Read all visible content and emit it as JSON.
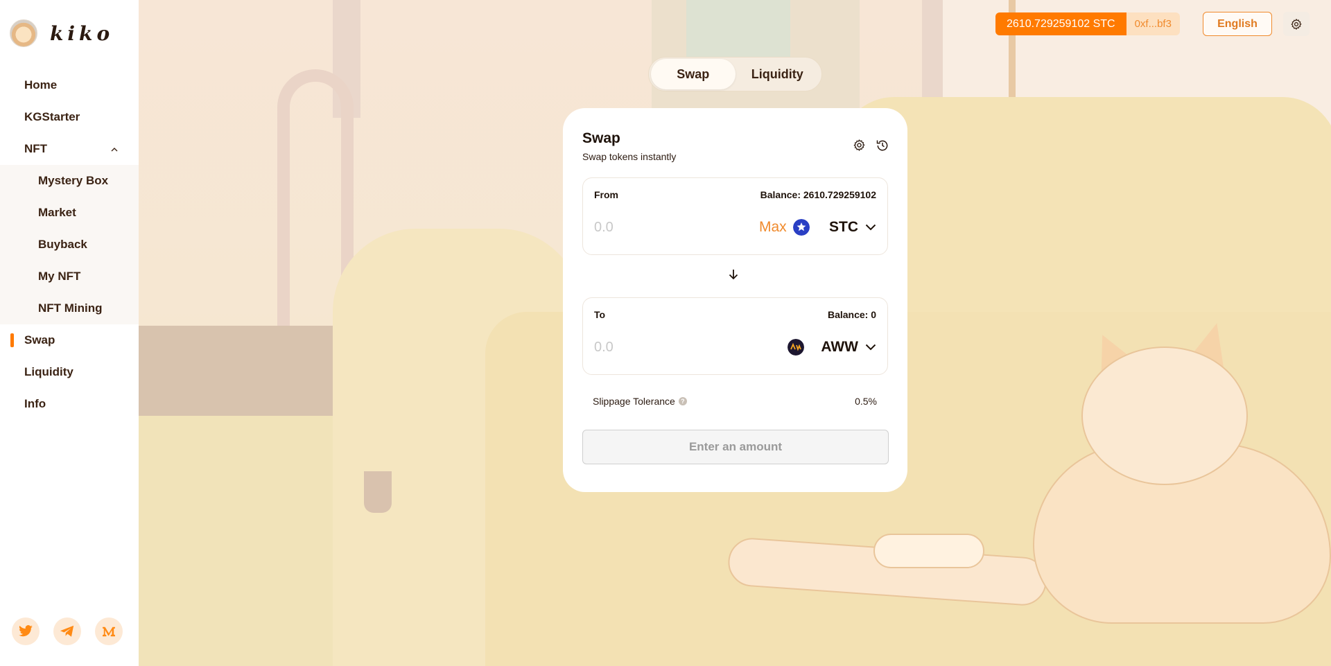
{
  "brand": {
    "name": "kiko"
  },
  "nav": {
    "items": [
      {
        "label": "Home"
      },
      {
        "label": "KGStarter"
      },
      {
        "label": "NFT"
      }
    ],
    "nft_sub": [
      {
        "label": "Mystery Box"
      },
      {
        "label": "Market"
      },
      {
        "label": "Buyback"
      },
      {
        "label": "My NFT"
      },
      {
        "label": "NFT Mining"
      }
    ],
    "bottom": [
      {
        "label": "Swap",
        "active": true
      },
      {
        "label": "Liquidity"
      },
      {
        "label": "Info"
      }
    ]
  },
  "socials": [
    "twitter-icon",
    "telegram-icon",
    "medium-icon"
  ],
  "header": {
    "balance": "2610.729259102  STC",
    "address": "0xf...bf3",
    "language": "English"
  },
  "tabs": [
    {
      "label": "Swap",
      "active": true
    },
    {
      "label": "Liquidity",
      "active": false
    }
  ],
  "swap": {
    "title": "Swap",
    "subtitle": "Swap tokens instantly",
    "from": {
      "label": "From",
      "balance": "Balance: 2610.729259102",
      "placeholder": "0.0",
      "max": "Max",
      "token": "STC"
    },
    "to": {
      "label": "To",
      "balance": "Balance: 0",
      "placeholder": "0.0",
      "token": "AWW"
    },
    "slippage_label": "Slippage Tolerance",
    "slippage_value": "0.5%",
    "action": "Enter an amount"
  },
  "colors": {
    "accent": "#ff7a00",
    "accent_light": "#fde0c0",
    "text_dark": "#2b1a10"
  }
}
